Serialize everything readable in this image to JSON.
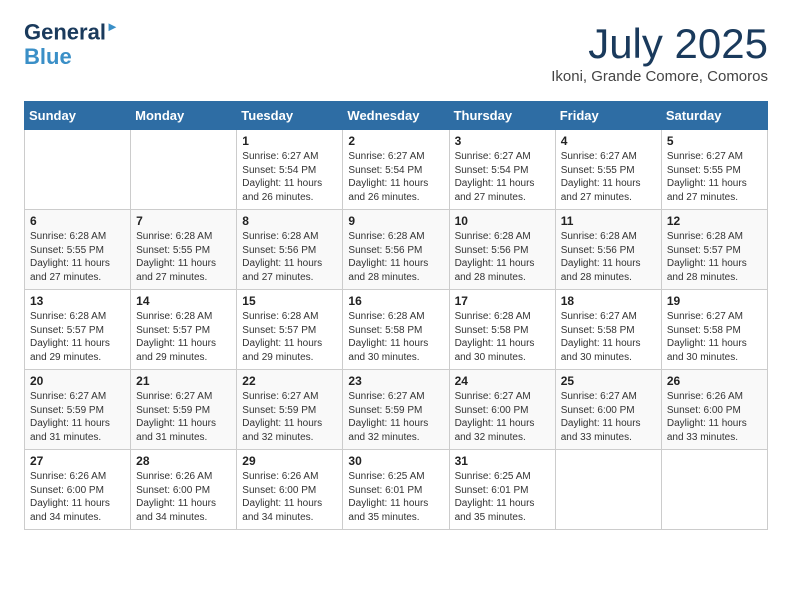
{
  "header": {
    "logo_line1": "General",
    "logo_line2": "Blue",
    "month": "July 2025",
    "location": "Ikoni, Grande Comore, Comoros"
  },
  "days_of_week": [
    "Sunday",
    "Monday",
    "Tuesday",
    "Wednesday",
    "Thursday",
    "Friday",
    "Saturday"
  ],
  "weeks": [
    [
      {
        "day": "",
        "content": ""
      },
      {
        "day": "",
        "content": ""
      },
      {
        "day": "1",
        "content": "Sunrise: 6:27 AM\nSunset: 5:54 PM\nDaylight: 11 hours and 26 minutes."
      },
      {
        "day": "2",
        "content": "Sunrise: 6:27 AM\nSunset: 5:54 PM\nDaylight: 11 hours and 26 minutes."
      },
      {
        "day": "3",
        "content": "Sunrise: 6:27 AM\nSunset: 5:54 PM\nDaylight: 11 hours and 27 minutes."
      },
      {
        "day": "4",
        "content": "Sunrise: 6:27 AM\nSunset: 5:55 PM\nDaylight: 11 hours and 27 minutes."
      },
      {
        "day": "5",
        "content": "Sunrise: 6:27 AM\nSunset: 5:55 PM\nDaylight: 11 hours and 27 minutes."
      }
    ],
    [
      {
        "day": "6",
        "content": "Sunrise: 6:28 AM\nSunset: 5:55 PM\nDaylight: 11 hours and 27 minutes."
      },
      {
        "day": "7",
        "content": "Sunrise: 6:28 AM\nSunset: 5:55 PM\nDaylight: 11 hours and 27 minutes."
      },
      {
        "day": "8",
        "content": "Sunrise: 6:28 AM\nSunset: 5:56 PM\nDaylight: 11 hours and 27 minutes."
      },
      {
        "day": "9",
        "content": "Sunrise: 6:28 AM\nSunset: 5:56 PM\nDaylight: 11 hours and 28 minutes."
      },
      {
        "day": "10",
        "content": "Sunrise: 6:28 AM\nSunset: 5:56 PM\nDaylight: 11 hours and 28 minutes."
      },
      {
        "day": "11",
        "content": "Sunrise: 6:28 AM\nSunset: 5:56 PM\nDaylight: 11 hours and 28 minutes."
      },
      {
        "day": "12",
        "content": "Sunrise: 6:28 AM\nSunset: 5:57 PM\nDaylight: 11 hours and 28 minutes."
      }
    ],
    [
      {
        "day": "13",
        "content": "Sunrise: 6:28 AM\nSunset: 5:57 PM\nDaylight: 11 hours and 29 minutes."
      },
      {
        "day": "14",
        "content": "Sunrise: 6:28 AM\nSunset: 5:57 PM\nDaylight: 11 hours and 29 minutes."
      },
      {
        "day": "15",
        "content": "Sunrise: 6:28 AM\nSunset: 5:57 PM\nDaylight: 11 hours and 29 minutes."
      },
      {
        "day": "16",
        "content": "Sunrise: 6:28 AM\nSunset: 5:58 PM\nDaylight: 11 hours and 30 minutes."
      },
      {
        "day": "17",
        "content": "Sunrise: 6:28 AM\nSunset: 5:58 PM\nDaylight: 11 hours and 30 minutes."
      },
      {
        "day": "18",
        "content": "Sunrise: 6:27 AM\nSunset: 5:58 PM\nDaylight: 11 hours and 30 minutes."
      },
      {
        "day": "19",
        "content": "Sunrise: 6:27 AM\nSunset: 5:58 PM\nDaylight: 11 hours and 30 minutes."
      }
    ],
    [
      {
        "day": "20",
        "content": "Sunrise: 6:27 AM\nSunset: 5:59 PM\nDaylight: 11 hours and 31 minutes."
      },
      {
        "day": "21",
        "content": "Sunrise: 6:27 AM\nSunset: 5:59 PM\nDaylight: 11 hours and 31 minutes."
      },
      {
        "day": "22",
        "content": "Sunrise: 6:27 AM\nSunset: 5:59 PM\nDaylight: 11 hours and 32 minutes."
      },
      {
        "day": "23",
        "content": "Sunrise: 6:27 AM\nSunset: 5:59 PM\nDaylight: 11 hours and 32 minutes."
      },
      {
        "day": "24",
        "content": "Sunrise: 6:27 AM\nSunset: 6:00 PM\nDaylight: 11 hours and 32 minutes."
      },
      {
        "day": "25",
        "content": "Sunrise: 6:27 AM\nSunset: 6:00 PM\nDaylight: 11 hours and 33 minutes."
      },
      {
        "day": "26",
        "content": "Sunrise: 6:26 AM\nSunset: 6:00 PM\nDaylight: 11 hours and 33 minutes."
      }
    ],
    [
      {
        "day": "27",
        "content": "Sunrise: 6:26 AM\nSunset: 6:00 PM\nDaylight: 11 hours and 34 minutes."
      },
      {
        "day": "28",
        "content": "Sunrise: 6:26 AM\nSunset: 6:00 PM\nDaylight: 11 hours and 34 minutes."
      },
      {
        "day": "29",
        "content": "Sunrise: 6:26 AM\nSunset: 6:00 PM\nDaylight: 11 hours and 34 minutes."
      },
      {
        "day": "30",
        "content": "Sunrise: 6:25 AM\nSunset: 6:01 PM\nDaylight: 11 hours and 35 minutes."
      },
      {
        "day": "31",
        "content": "Sunrise: 6:25 AM\nSunset: 6:01 PM\nDaylight: 11 hours and 35 minutes."
      },
      {
        "day": "",
        "content": ""
      },
      {
        "day": "",
        "content": ""
      }
    ]
  ]
}
